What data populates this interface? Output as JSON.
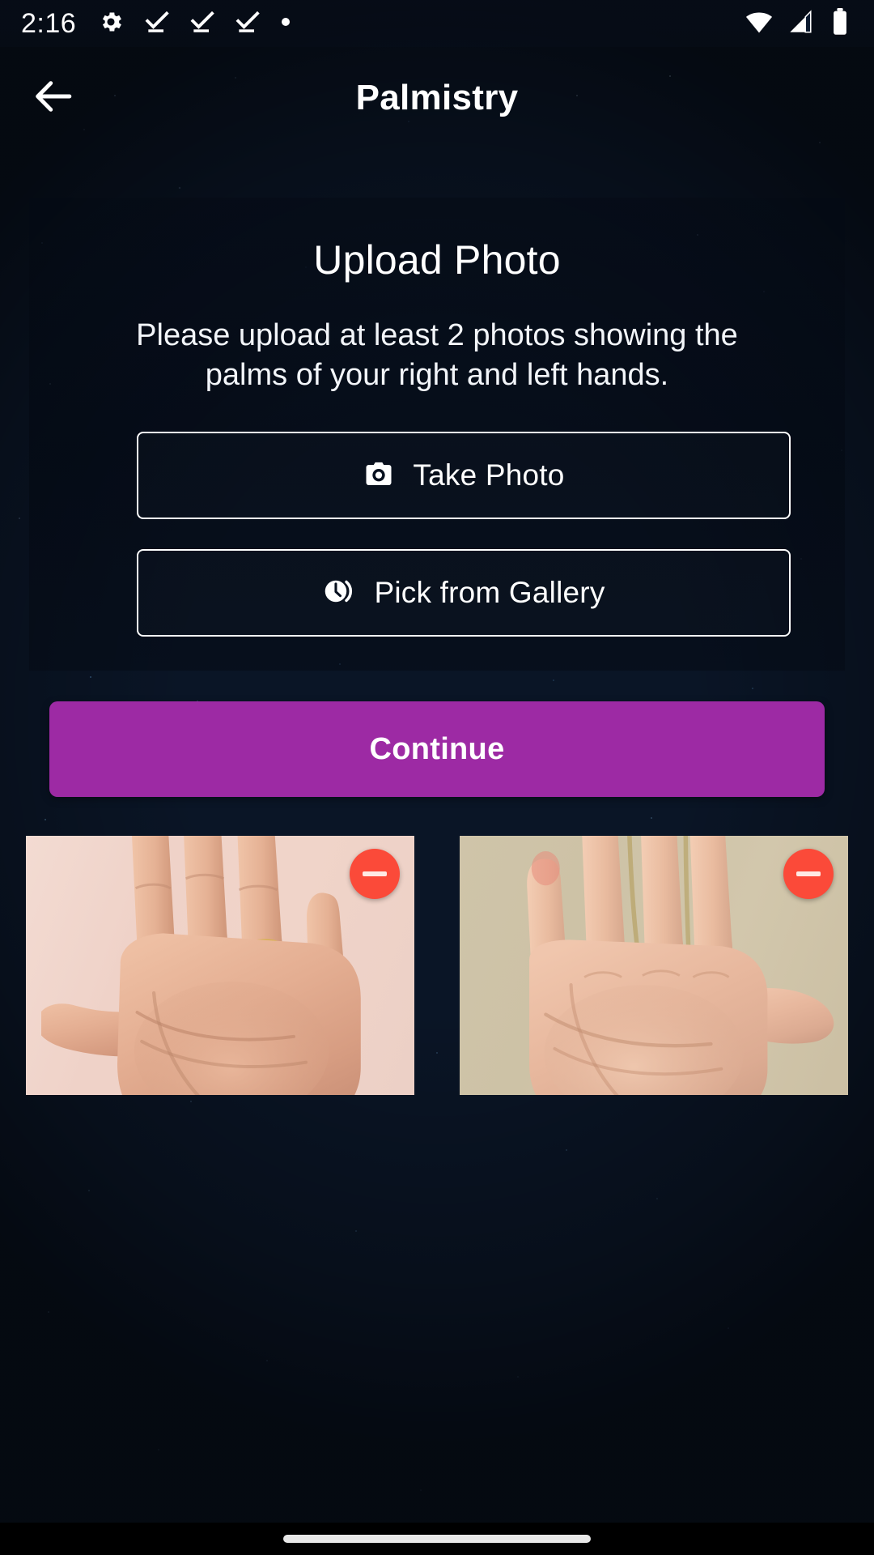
{
  "status_bar": {
    "time": "2:16",
    "left_icons": [
      "gear-icon",
      "task-complete-icon",
      "task-complete-icon",
      "task-complete-icon",
      "dot-icon"
    ],
    "right_icons": [
      "wifi-icon",
      "cellular-signal-icon",
      "battery-full-icon"
    ]
  },
  "app_bar": {
    "back_icon": "arrow-left-icon",
    "title": "Palmistry"
  },
  "upload_card": {
    "title": "Upload Photo",
    "subtitle": "Please upload at least 2 photos showing the palms of your right and left hands.",
    "take_photo": {
      "label": "Take Photo",
      "icon": "camera-icon"
    },
    "pick_gallery": {
      "label": "Pick from Gallery",
      "icon": "history-clock-icon"
    }
  },
  "continue_button": {
    "label": "Continue",
    "color": "#9d2aa4",
    "text_color": "#ffffff"
  },
  "thumbnails": [
    {
      "alt": "right-hand-palm-photo",
      "remove_icon": "minus-circle-icon",
      "remove_color": "#fb4a39"
    },
    {
      "alt": "left-hand-palm-photo",
      "remove_icon": "minus-circle-icon",
      "remove_color": "#fb4a39"
    }
  ],
  "navigation_bar": {
    "gesture_pill": "home-gesture-pill"
  },
  "theme": {
    "background": "#0a1830",
    "accent": "#9d2aa4",
    "text": "#ffffff",
    "danger": "#fb4a39"
  }
}
